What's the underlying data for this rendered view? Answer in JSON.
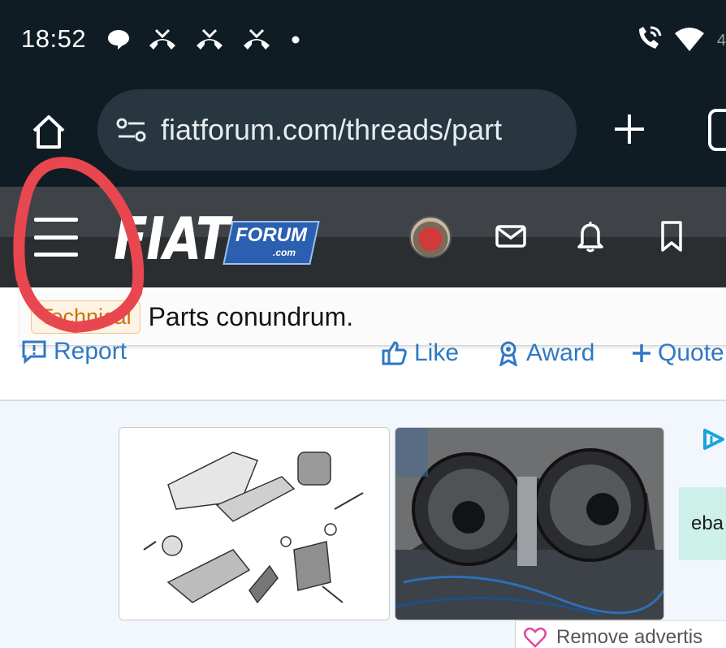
{
  "status_bar": {
    "time": "18:52",
    "left_icons": [
      "chat-bubble-icon",
      "missed-call-icon",
      "missed-call-icon",
      "missed-call-icon",
      "dot-icon"
    ],
    "right_icons": [
      "wifi-call-icon",
      "wifi-icon"
    ],
    "extra": "4"
  },
  "browser": {
    "url": "fiatforum.com/threads/part",
    "home_icon": "home-icon",
    "site_info_icon": "site-settings-icon",
    "new_tab_icon": "plus-icon",
    "tabs_icon": "tabs-icon"
  },
  "site_header": {
    "logo_main": "FIAT",
    "logo_sub": "FORUM",
    "logo_domain": ".com",
    "icons": [
      "avatar",
      "mail-icon",
      "bell-icon",
      "bookmark-icon"
    ]
  },
  "thread": {
    "tag": "Technical",
    "title": "Parts conundrum."
  },
  "actions": {
    "report": "Report",
    "like": "Like",
    "award": "Award",
    "quote": "Quote"
  },
  "ad": {
    "ebay_text": "eba",
    "remove_text": "Remove advertis"
  },
  "colors": {
    "status_bg": "#0f1c24",
    "url_pill": "#27363f",
    "header_bg": "#2b2e31",
    "link_blue": "#2f78c4",
    "tag_orange": "#c8710a",
    "annotation_red": "#e8474f"
  }
}
